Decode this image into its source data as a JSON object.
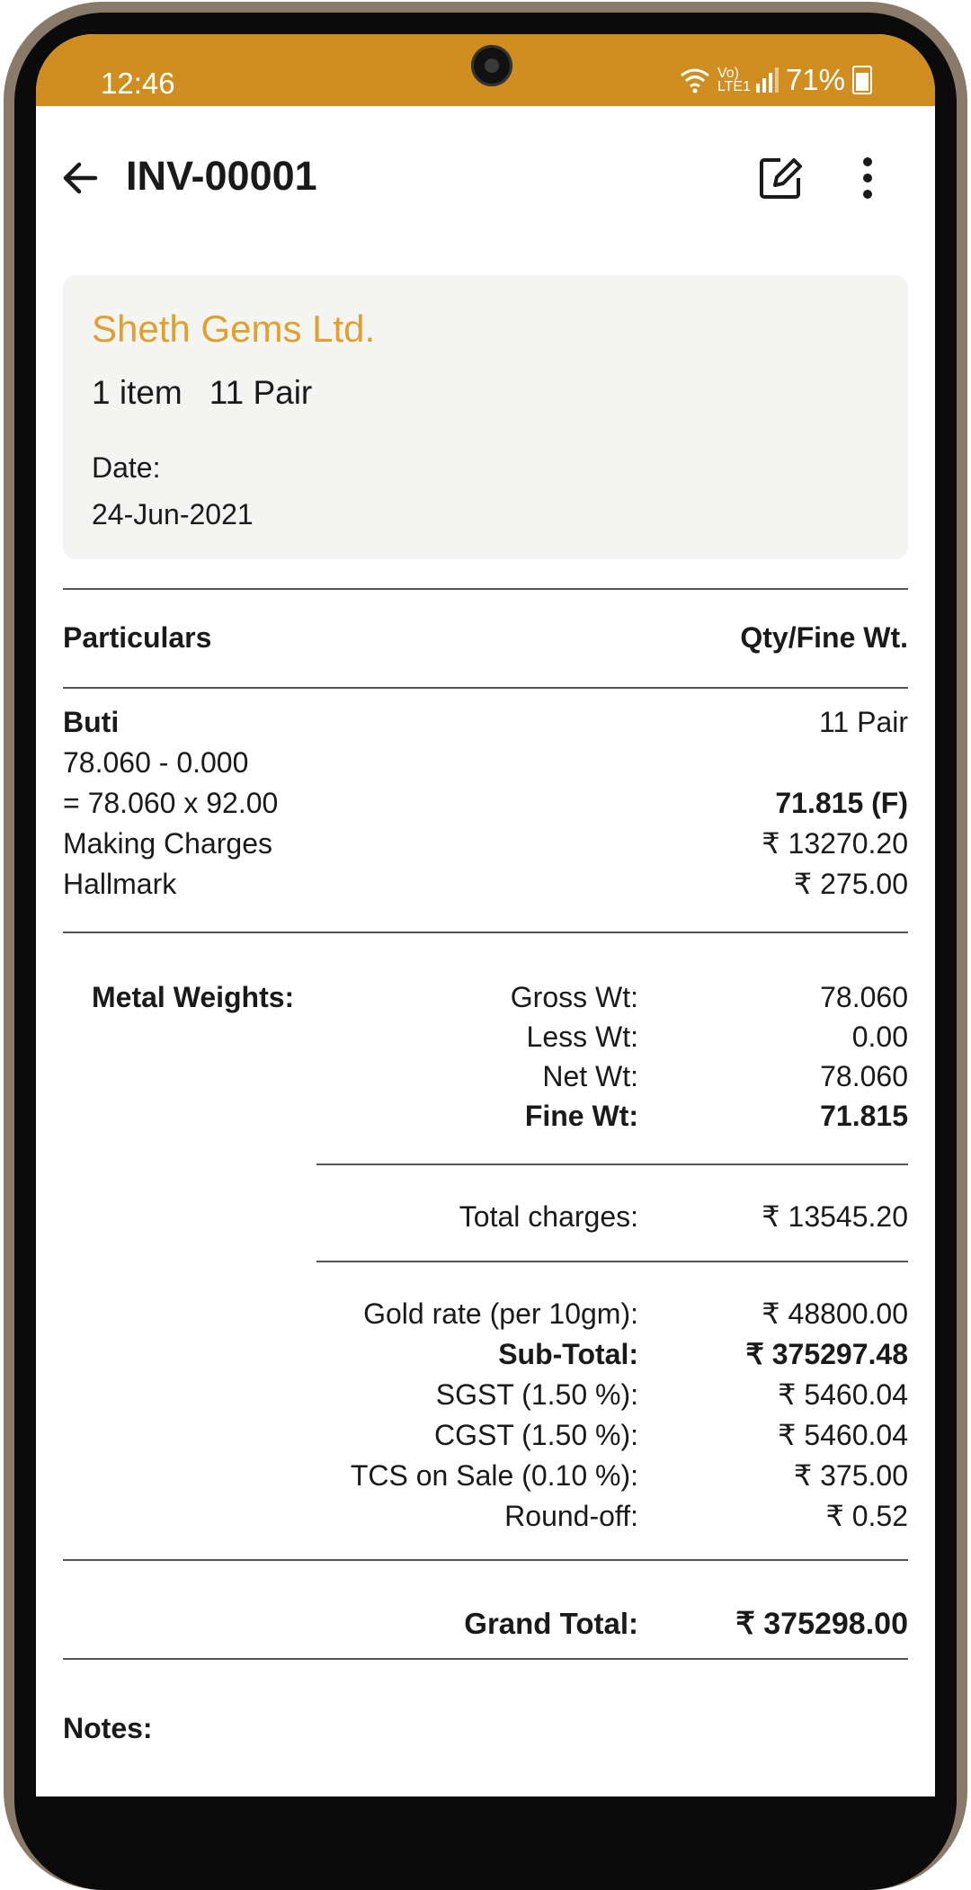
{
  "status_bar": {
    "time": "12:46",
    "network": "Vo) LTE1",
    "battery": "71%"
  },
  "header": {
    "title": "INV-00001"
  },
  "party": {
    "name": "Sheth Gems Ltd.",
    "item_count": "1 item",
    "pair_count": "11 Pair",
    "date_label": "Date:",
    "date_value": "24-Jun-2021"
  },
  "table": {
    "col_particulars": "Particulars",
    "col_qty": "Qty/Fine Wt.",
    "item": {
      "name": "Buti",
      "qty": "11 Pair",
      "weight_calc": "78.060 - 0.000",
      "fine_calc": "= 78.060 x 92.00",
      "fine_wt": "71.815 (F)",
      "making_label": "Making Charges",
      "making_value": "₹ 13270.20",
      "hallmark_label": "Hallmark",
      "hallmark_value": "₹ 275.00"
    }
  },
  "metal_weights": {
    "title": "Metal Weights:",
    "gross_label": "Gross Wt:",
    "gross_value": "78.060",
    "less_label": "Less Wt:",
    "less_value": "0.00",
    "net_label": "Net Wt:",
    "net_value": "78.060",
    "fine_label": "Fine Wt:",
    "fine_value": "71.815"
  },
  "charges": {
    "total_label": "Total charges:",
    "total_value": "₹ 13545.20"
  },
  "summary": {
    "gold_rate_label": "Gold rate (per 10gm):",
    "gold_rate_value": "₹ 48800.00",
    "subtotal_label": "Sub-Total:",
    "subtotal_value": "₹ 375297.48",
    "sgst_label": "SGST (1.50 %):",
    "sgst_value": "₹ 5460.04",
    "cgst_label": "CGST (1.50 %):",
    "cgst_value": "₹ 5460.04",
    "tcs_label": "TCS on Sale (0.10 %):",
    "tcs_value": "₹ 375.00",
    "roundoff_label": "Round-off:",
    "roundoff_value": "₹ 0.52",
    "grand_label": "Grand Total:",
    "grand_value": "₹ 375298.00"
  },
  "notes": {
    "label": "Notes:"
  },
  "colors": {
    "status_bar": "#d08e21",
    "accent": "#e0a02d",
    "card_bg": "#f4f4f2"
  }
}
